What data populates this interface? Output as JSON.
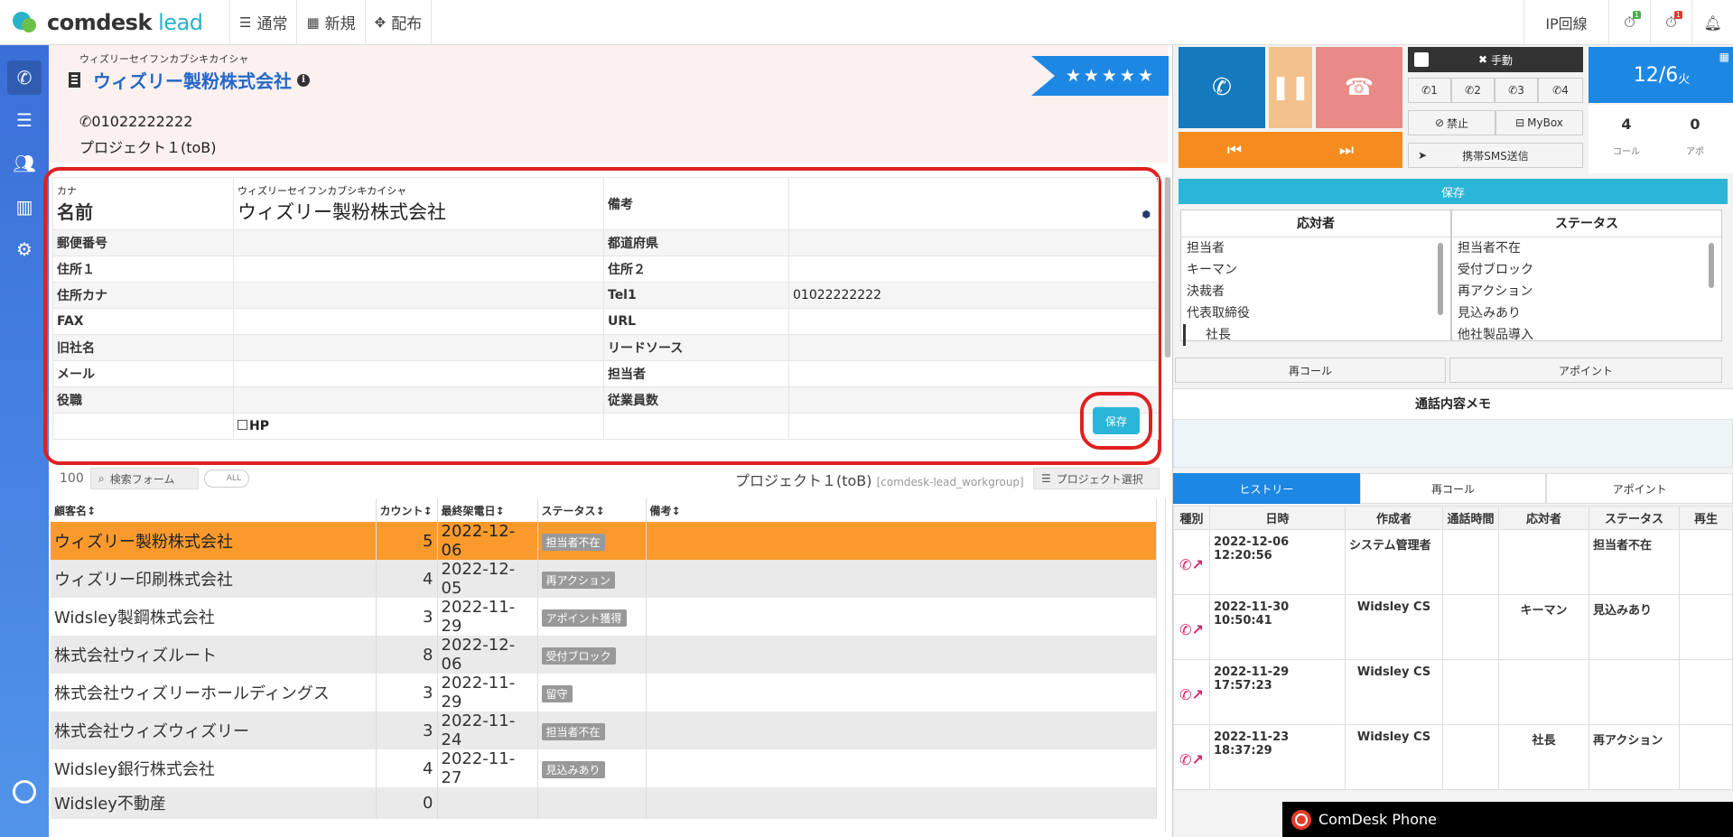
{
  "app": {
    "logo_main": "comdesk",
    "logo_accent": " lead"
  },
  "topnav": [
    {
      "icon": "☰",
      "label": "通常"
    },
    {
      "icon": "▦",
      "label": "新規"
    },
    {
      "icon": "✥",
      "label": "配布"
    }
  ],
  "top_right": {
    "ip_line": "IP回線",
    "badge_green": "1",
    "badge_red": "1"
  },
  "customer": {
    "kana": "ウィズリーセイフンカブシキカイシャ",
    "name": "ウィズリー製粉株式会社",
    "phone": "01022222222",
    "project": "プロジェクト１(toB)",
    "stars": "★★★★★"
  },
  "form": {
    "kana_label": "カナ",
    "name_label": "名前",
    "kana_value": "ウィズリーセイフンカブシキカイシャ",
    "name_value": "ウィズリー製粉株式会社",
    "note_label": "備考",
    "rows": [
      {
        "l1": "郵便番号",
        "v1": "",
        "l2": "都道府県",
        "v2": ""
      },
      {
        "l1": "住所１",
        "v1": "",
        "l2": "住所２",
        "v2": ""
      },
      {
        "l1": "住所カナ",
        "v1": "",
        "l2": "Tel1",
        "v2": "01022222222"
      },
      {
        "l1": "FAX",
        "v1": "",
        "l2": "URL",
        "v2": ""
      },
      {
        "l1": "旧社名",
        "v1": "",
        "l2": "リードソース",
        "v2": ""
      },
      {
        "l1": "メール",
        "v1": "",
        "l2": "担当者",
        "v2": ""
      },
      {
        "l1": "役職",
        "v1": "",
        "l2": "従業員数",
        "v2": ""
      }
    ],
    "hp_label": "HP",
    "save_label": "保存"
  },
  "list": {
    "count": "100",
    "search_label": "検索フォーム",
    "toggle_label": "ALL",
    "project_title": "プロジェクト１(toB)",
    "workgroup": "[comdesk-lead_workgroup]",
    "project_select": "プロジェクト選択",
    "headers": [
      "顧客名↕",
      "カウント↕",
      "最終架電日↕",
      "ステータス↕",
      "備考↕"
    ],
    "rows": [
      {
        "name": "ウィズリー製粉株式会社",
        "count": "5",
        "date": "2022-12-06",
        "status": "担当者不在"
      },
      {
        "name": "ウィズリー印刷株式会社",
        "count": "4",
        "date": "2022-12-05",
        "status": "再アクション"
      },
      {
        "name": "Widsley製鋼株式会社",
        "count": "3",
        "date": "2022-11-29",
        "status": "アポイント獲得"
      },
      {
        "name": "株式会社ウィズルート",
        "count": "8",
        "date": "2022-12-06",
        "status": "受付ブロック"
      },
      {
        "name": "株式会社ウィズリーホールディングス",
        "count": "3",
        "date": "2022-11-29",
        "status": "留守"
      },
      {
        "name": "株式会社ウィズウィズリー",
        "count": "3",
        "date": "2022-11-24",
        "status": "担当者不在"
      },
      {
        "name": "Widsley銀行株式会社",
        "count": "4",
        "date": "2022-11-27",
        "status": "見込みあり"
      },
      {
        "name": "Widsley不動産",
        "count": "0",
        "date": "",
        "status": ""
      }
    ]
  },
  "right": {
    "manual_label": "手動",
    "lines": [
      "1",
      "2",
      "3",
      "4"
    ],
    "block_label": "禁止",
    "mybox_label": "MyBox",
    "sms_label": "携帯SMS送信",
    "date": "12/6",
    "weekday": "火",
    "calls_count": "4",
    "calls_label": "コール",
    "appo_count": "0",
    "appo_label": "アポ",
    "save_label": "保存",
    "responder_header": "応対者",
    "responders": [
      "担当者",
      "キーマン",
      "決裁者",
      "代表取締役",
      "社長"
    ],
    "status_header": "ステータス",
    "statuses": [
      "担当者不在",
      "受付ブロック",
      "再アクション",
      "見込みあり",
      "他社製品導入"
    ],
    "recall_label": "再コール",
    "appoint_label": "アポイント",
    "memo_header": "通話内容メモ",
    "tabs": [
      "ヒストリー",
      "再コール",
      "アポイント"
    ],
    "history_headers": [
      "種別",
      "日時",
      "作成者",
      "通話時間",
      "応対者",
      "ステータス",
      "再生"
    ],
    "history": [
      {
        "dt": "2022-12-06 12:20:56",
        "by": "システム管理者",
        "dur": "",
        "resp": "",
        "status": "担当者不在"
      },
      {
        "dt": "2022-11-30 10:50:41",
        "by": "Widsley CS",
        "dur": "",
        "resp": "キーマン",
        "status": "見込みあり"
      },
      {
        "dt": "2022-11-29 17:57:23",
        "by": "Widsley CS",
        "dur": "",
        "resp": "",
        "status": ""
      },
      {
        "dt": "2022-11-23 18:37:29",
        "by": "Widsley CS",
        "dur": "",
        "resp": "社長",
        "status": "再アクション"
      }
    ]
  },
  "phone_bar": {
    "label": "ComDesk Phone"
  },
  "colors": {
    "accent": "#1d87e4",
    "selected_row": "#fb9a2c",
    "highlight_ring": "#e02020",
    "save": "#2bb5d8"
  }
}
